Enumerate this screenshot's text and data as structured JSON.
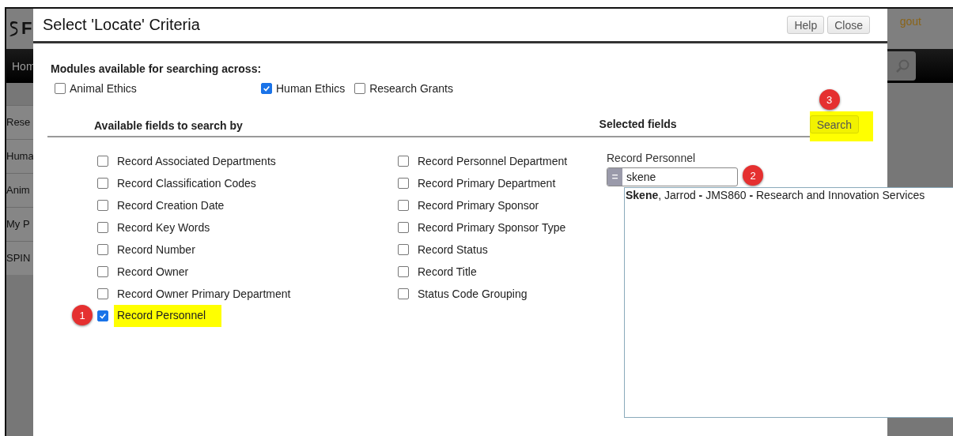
{
  "background": {
    "logo_text": "F",
    "nav_item": "Hom",
    "top_link": "gout",
    "sidebar_items": [
      "Rese",
      "Huma",
      "Anim",
      "My P",
      "SPIN"
    ]
  },
  "dialog": {
    "title": "Select 'Locate' Criteria",
    "buttons": [
      "Help",
      "Close"
    ]
  },
  "modules": {
    "heading": "Modules available for searching across:",
    "items": [
      {
        "label": "Animal Ethics",
        "checked": false
      },
      {
        "label": "Human Ethics",
        "checked": true
      },
      {
        "label": "Research Grants",
        "checked": false
      }
    ]
  },
  "available": {
    "heading": "Available fields to search by",
    "columns": [
      [
        {
          "label": "Record Associated Departments",
          "checked": false,
          "highlighted": false
        },
        {
          "label": "Record Classification Codes",
          "checked": false,
          "highlighted": false
        },
        {
          "label": "Record Creation Date",
          "checked": false,
          "highlighted": false
        },
        {
          "label": "Record Key Words",
          "checked": false,
          "highlighted": false
        },
        {
          "label": "Record Number",
          "checked": false,
          "highlighted": false
        },
        {
          "label": "Record Owner",
          "checked": false,
          "highlighted": false
        },
        {
          "label": "Record Owner Primary Department",
          "checked": false,
          "highlighted": false
        },
        {
          "label": "Record Personnel",
          "checked": true,
          "highlighted": true,
          "callout": "1"
        }
      ],
      [
        {
          "label": "Record Personnel Department",
          "checked": false,
          "highlighted": false
        },
        {
          "label": "Record Primary Department",
          "checked": false,
          "highlighted": false
        },
        {
          "label": "Record Primary Sponsor",
          "checked": false,
          "highlighted": false
        },
        {
          "label": "Record Primary Sponsor Type",
          "checked": false,
          "highlighted": false
        },
        {
          "label": "Record Status",
          "checked": false,
          "highlighted": false
        },
        {
          "label": "Record Title",
          "checked": false,
          "highlighted": false
        },
        {
          "label": "Status Code Grouping",
          "checked": false,
          "highlighted": false
        }
      ]
    ]
  },
  "selected": {
    "heading": "Selected fields",
    "search_button": {
      "label": "Search",
      "highlighted": true,
      "callout": "3"
    },
    "field": {
      "label": "Record Personnel",
      "operator": "=",
      "value": "skene",
      "callout": "2"
    }
  },
  "suggestions": [
    "**Skene**, Jarrod **-** JMS860 **-** Research and Innovation Services"
  ]
}
